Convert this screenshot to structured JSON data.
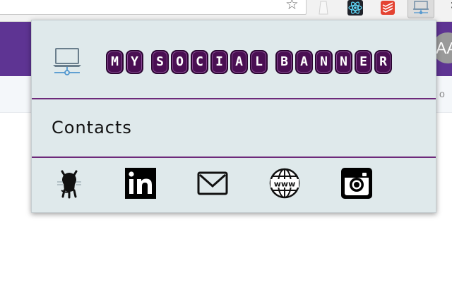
{
  "page": {
    "avatar_initials": "AA",
    "subbar_text": "o"
  },
  "popup": {
    "title": "My Social Banner",
    "title_letters": [
      "M",
      "Y",
      " ",
      "S",
      "O",
      "C",
      "I",
      "A",
      "L",
      " ",
      "B",
      "A",
      "N",
      "N",
      "E",
      "R"
    ],
    "section_title": "Contacts",
    "social_links": [
      {
        "name": "github",
        "icon": "github-icon"
      },
      {
        "name": "linkedin",
        "icon": "linkedin-icon"
      },
      {
        "name": "email",
        "icon": "mail-icon"
      },
      {
        "name": "website",
        "icon": "www-globe-icon"
      },
      {
        "name": "instagram",
        "icon": "instagram-icon"
      }
    ]
  },
  "colors": {
    "header_purple": "#5e3493",
    "popup_bg": "#dfe9eb",
    "divider": "#6d2a7a",
    "title_letter_bg": "#4a0f53"
  }
}
